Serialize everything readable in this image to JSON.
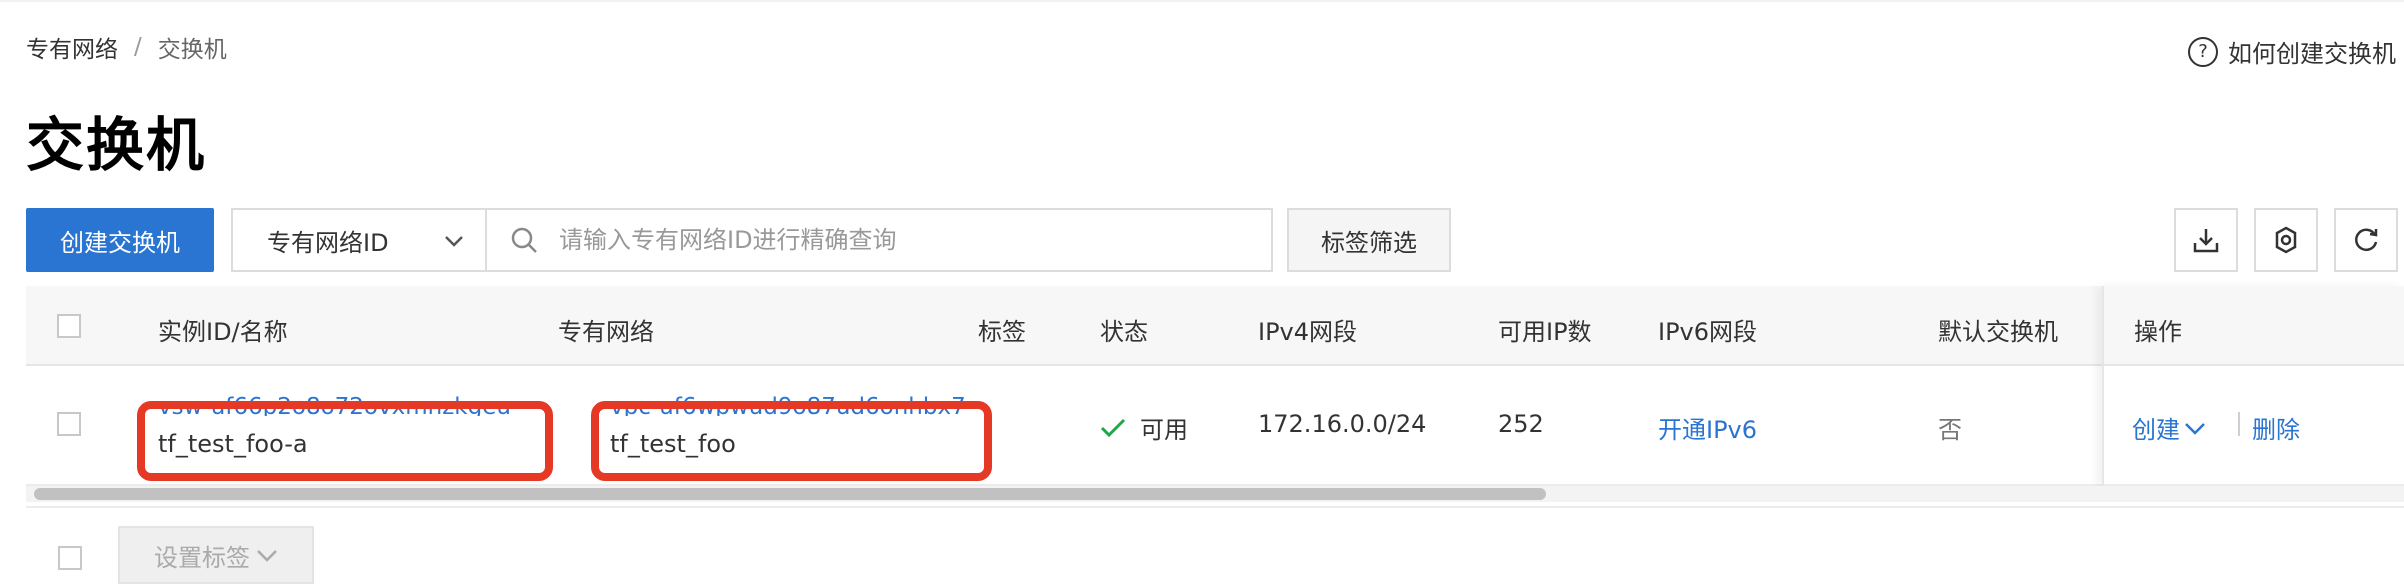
{
  "breadcrumb": {
    "parent": "专有网络",
    "separator": "/",
    "current": "交换机"
  },
  "help": {
    "icon": "question-circle-icon",
    "label": "如何创建交换机"
  },
  "page": {
    "title": "交换机"
  },
  "toolbar": {
    "create_label": "创建交换机",
    "filter_select": "专有网络ID",
    "search_placeholder": "请输入专有网络ID进行精确查询",
    "tag_filter_label": "标签筛选",
    "icons": [
      "download-icon",
      "settings-icon",
      "refresh-icon"
    ]
  },
  "table": {
    "columns": {
      "instance": "实例ID/名称",
      "vpc": "专有网络",
      "tags": "标签",
      "status": "状态",
      "ipv4": "IPv4网段",
      "available_ip": "可用IP数",
      "ipv6": "IPv6网段",
      "default_switch": "默认交换机",
      "actions": "操作"
    },
    "rows": [
      {
        "instance_id": "vsw-uf66p2o8o72ovxmnzkgeu",
        "instance_name": "tf_test_foo-a",
        "vpc_id": "vpc-uf6wpwud9o87ud6onhbx7",
        "vpc_name": "tf_test_foo",
        "status": "可用",
        "ipv4": "172.16.0.0/24",
        "available_ip": "252",
        "ipv6_action": "开通IPv6",
        "default_switch": "否",
        "action_create": "创建",
        "action_delete": "删除"
      }
    ]
  },
  "footer": {
    "set_tags_label": "设置标签"
  },
  "colors": {
    "primary": "#2a74d2",
    "annotation_red": "#e53925",
    "success_green": "#1fa84a"
  }
}
